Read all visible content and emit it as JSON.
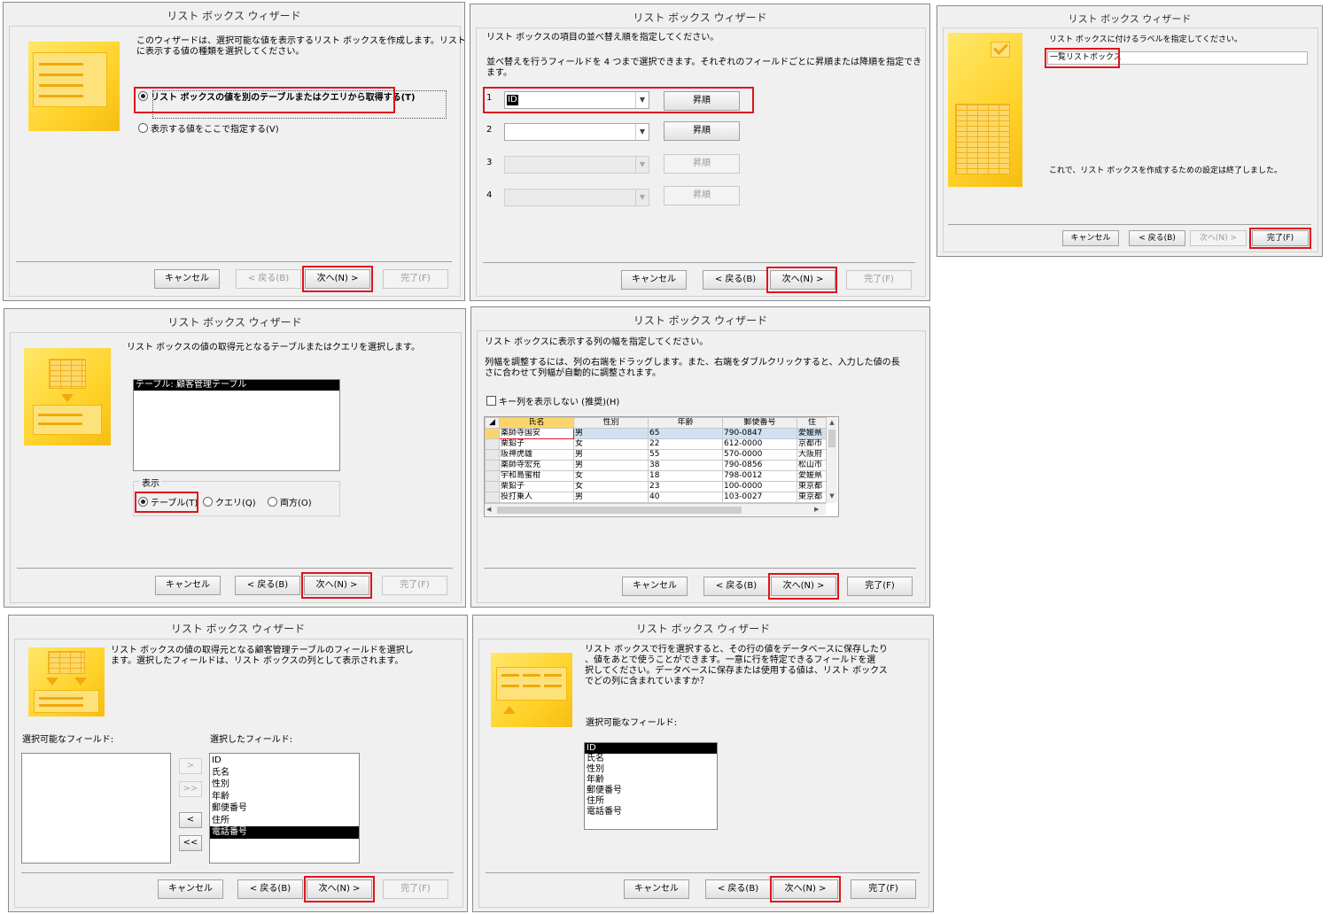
{
  "common": {
    "wizard_title": "リスト ボックス ウィザード",
    "cancel": "キャンセル",
    "back": "< 戻る(B)",
    "next": "次へ(N) >",
    "finish": "完了(F)"
  },
  "p1": {
    "desc1": "このウィザードは、選択可能な値を表示するリスト ボックスを作成します。リスト ボックス",
    "desc2": "に表示する値の種類を選択してください。",
    "opt_query": "リスト ボックスの値を別のテーブルまたはクエリから取得する(T)",
    "opt_type": "表示する値をここで指定する(V)"
  },
  "p2": {
    "desc": "リスト ボックスの値の取得元となるテーブルまたはクエリを選択します。",
    "list_items": [
      "テーブル: 顧客管理テーブル"
    ],
    "group_label": "表示",
    "opt_table": "テーブル(T)",
    "opt_query": "クエリ(Q)",
    "opt_both": "両方(O)"
  },
  "p3": {
    "desc1": "リスト ボックスの値の取得元となる顧客管理テーブルのフィールドを選択し",
    "desc2": "ます。選択したフィールドは、リスト ボックスの列として表示されます。",
    "available_label": "選択可能なフィールド:",
    "selected_label": "選択したフィールド:",
    "selected_fields": [
      "ID",
      "氏名",
      "性別",
      "年齢",
      "郵便番号",
      "住所",
      "電話番号"
    ],
    "btn_add": ">",
    "btn_add_all": ">>",
    "btn_remove": "<",
    "btn_remove_all": "<<"
  },
  "p4": {
    "desc1": "リスト ボックスの項目の並べ替え順を指定してください。",
    "desc2": "並べ替えを行うフィールドを 4 つまで選択できます。それぞれのフィールドごとに昇順または降順を指定でき",
    "desc3": "ます。",
    "rows": [
      {
        "num": "1",
        "value": "ID",
        "order": "昇順"
      },
      {
        "num": "2",
        "value": "",
        "order": "昇順"
      },
      {
        "num": "3",
        "value": "",
        "order": "昇順"
      },
      {
        "num": "4",
        "value": "",
        "order": "昇順"
      }
    ]
  },
  "p5": {
    "desc1": "リスト ボックスに表示する列の幅を指定してください。",
    "desc2": "列幅を調整するには、列の右端をドラッグします。また、右端をダブルクリックすると、入力した値の長",
    "desc3": "さに合わせて列幅が自動的に調整されます。",
    "checkbox_label": "キー列を表示しない (推奨)(H)",
    "columns": [
      "氏名",
      "性別",
      "年齢",
      "郵便番号",
      "住"
    ],
    "rows": [
      [
        "薬師寺国安",
        "男",
        "65",
        "790-0847",
        "愛媛県"
      ],
      [
        "栗鉛子",
        "女",
        "22",
        "612-0000",
        "京都市"
      ],
      [
        "阪神虎雄",
        "男",
        "55",
        "570-0000",
        "大阪府"
      ],
      [
        "薬師寺宏充",
        "男",
        "38",
        "790-0856",
        "松山市"
      ],
      [
        "宇和島蜜柑",
        "女",
        "18",
        "798-0012",
        "愛媛県"
      ],
      [
        "栗鉛子",
        "女",
        "23",
        "100-0000",
        "東京都"
      ],
      [
        "投打乗人",
        "男",
        "40",
        "103-0027",
        "東京都"
      ]
    ]
  },
  "p6": {
    "desc1": "リスト ボックスで行を選択すると、その行の値をデータベースに保存したり",
    "desc2": "、値をあとで使うことができます。一意に行を特定できるフィールドを選",
    "desc3": "択してください。データベースに保存または使用する値は、リスト ボックス",
    "desc4": "でどの列に含まれていますか？",
    "available_label": "選択可能なフィールド:",
    "fields": [
      "ID",
      "氏名",
      "性別",
      "年齢",
      "郵便番号",
      "住所",
      "電話番号"
    ]
  },
  "p7": {
    "desc": "リスト ボックスに付けるラベルを指定してください。",
    "label_value": "一覧リストボックス",
    "done_text": "これで、リスト ボックスを作成するための設定は終了しました。"
  }
}
